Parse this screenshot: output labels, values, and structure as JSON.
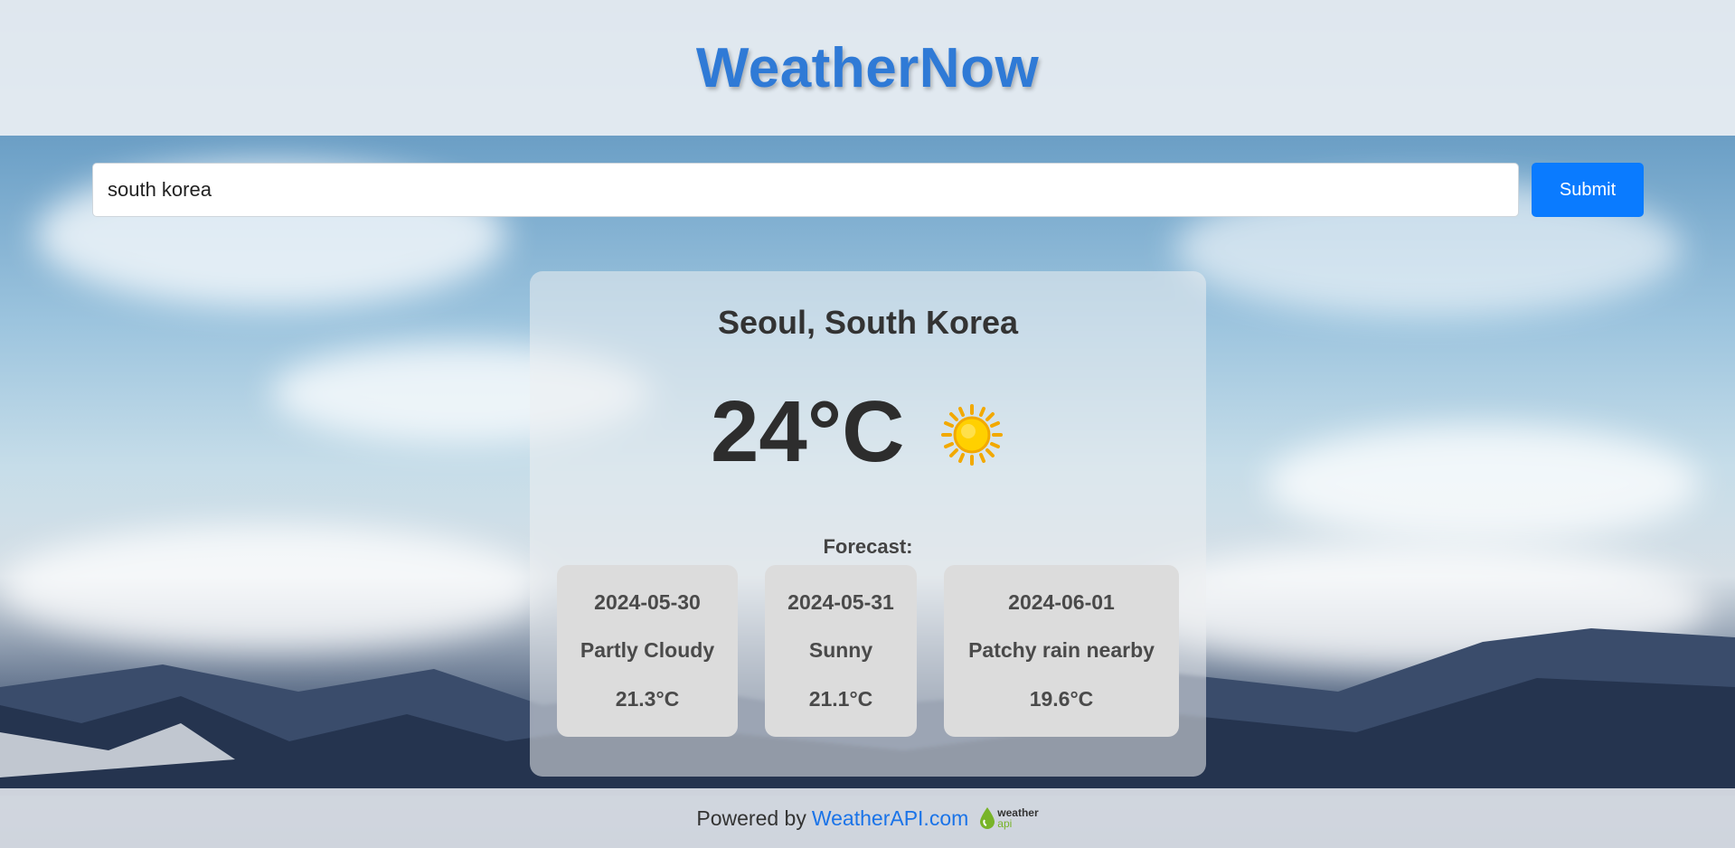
{
  "header": {
    "title": "WeatherNow"
  },
  "search": {
    "value": "south korea",
    "placeholder": "",
    "submit_label": "Submit"
  },
  "current": {
    "location": "Seoul, South Korea",
    "temperature": "24°C",
    "icon": "sun-icon"
  },
  "forecast": {
    "label": "Forecast:",
    "days": [
      {
        "date": "2024-05-30",
        "condition": "Partly Cloudy",
        "temp": "21.3°C"
      },
      {
        "date": "2024-05-31",
        "condition": "Sunny",
        "temp": "21.1°C"
      },
      {
        "date": "2024-06-01",
        "condition": "Patchy rain nearby",
        "temp": "19.6°C"
      }
    ]
  },
  "footer": {
    "prefix": "Powered by",
    "link_text": "WeatherAPI.com",
    "logo_top": "weather",
    "logo_bottom": "api"
  },
  "colors": {
    "brand": "#2f7ad6",
    "button": "#0a7bff",
    "link": "#1a73e8"
  }
}
